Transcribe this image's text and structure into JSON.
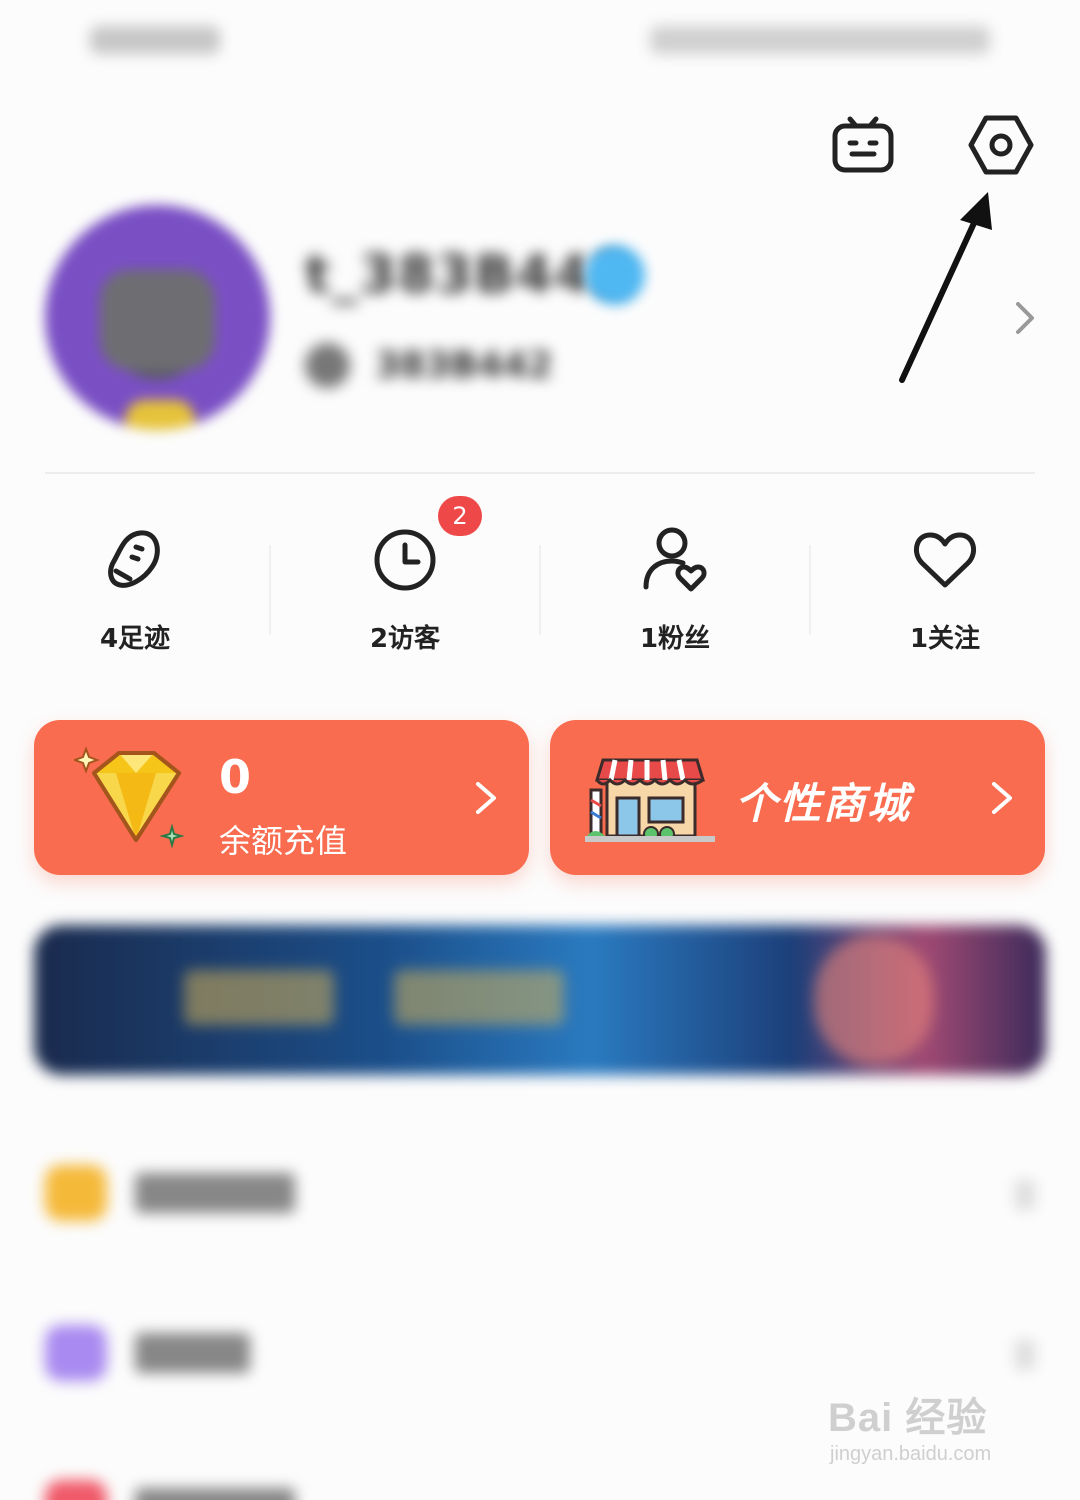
{
  "status_bar": {
    "left": "",
    "right": ""
  },
  "header": {
    "bili_icon": "bilibili-tv-icon",
    "settings_icon": "settings-hexagon-icon"
  },
  "profile": {
    "username": "t_383B442",
    "uid": "383B442",
    "chevron_icon": "chevron-right-icon"
  },
  "stats": [
    {
      "label": "4足迹",
      "icon": "footprint-icon"
    },
    {
      "label": "2访客",
      "icon": "clock-icon",
      "badge": "2"
    },
    {
      "label": "1粉丝",
      "icon": "fans-icon"
    },
    {
      "label": "1关注",
      "icon": "heart-icon"
    }
  ],
  "cards": {
    "balance": {
      "value": "0",
      "label": "余额充值",
      "icon": "diamond-icon"
    },
    "mall": {
      "title": "个性商城",
      "icon": "shop-icon"
    }
  },
  "watermark": {
    "title": "Bai 经验",
    "subtitle": "jingyan.baidu.com"
  },
  "colors": {
    "accent": "#f96c4f",
    "badge": "#ef4848",
    "background": "#fcfcfc"
  }
}
